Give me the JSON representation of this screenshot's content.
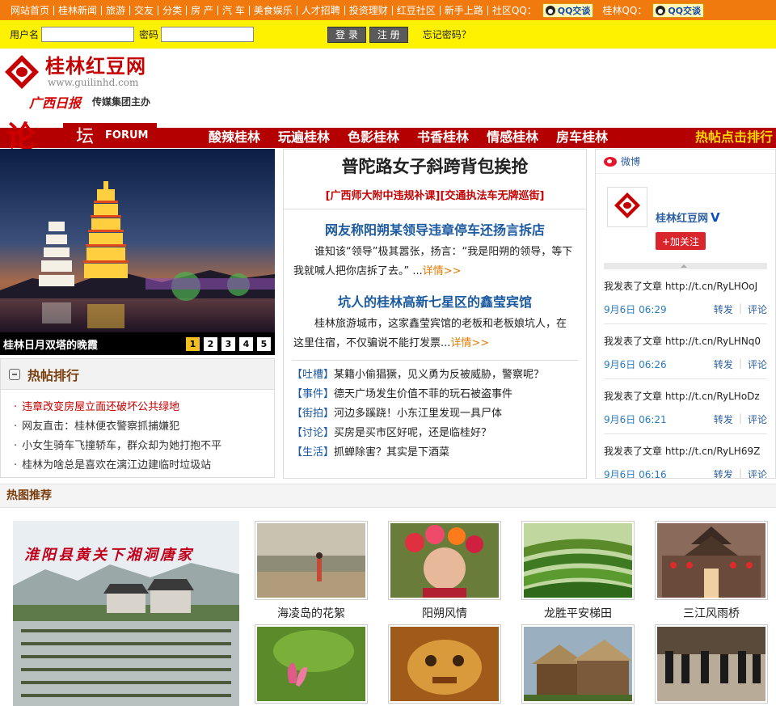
{
  "topnav": {
    "items": [
      "网站首页",
      "桂林新闻",
      "旅游",
      "交友",
      "分类",
      "房 产",
      "汽 车",
      "美食娱乐",
      "人才招聘",
      "投资理财",
      "红豆社区",
      "新手上路"
    ],
    "community_qq_label": "社区QQ：",
    "qq_btn_label": "QQ交谈",
    "guilin_qq_label": "桂林QQ："
  },
  "login": {
    "username_label": "用户名",
    "password_label": "密码",
    "username_value": "",
    "password_value": "",
    "login_btn": "登 录",
    "register_btn": "注 册",
    "forgot": "忘记密码？"
  },
  "logo": {
    "title": "桂林红豆网",
    "url": "www.guilinhd.com",
    "gx": "广西日报",
    "sub": "传媒集团主办"
  },
  "forum": {
    "lun": "论",
    "tan": "坛",
    "en": "FORUM",
    "nav": [
      "酸辣桂林",
      "玩遍桂林",
      "色影桂林",
      "书香桂林",
      "情感桂林",
      "房车桂林"
    ],
    "hot_rank": "热帖点击排行"
  },
  "slideshow": {
    "caption": "桂林日月双塔的晚霞",
    "pages": [
      "1",
      "2",
      "3",
      "4",
      "5"
    ],
    "active": 0
  },
  "hot_posts": {
    "title": "热帖排行",
    "items": [
      "违章改变房屋立面还破坏公共绿地",
      "网友直击：桂林便衣警察抓捕嫌犯",
      "小女生骑车飞撞轿车，群众却为她打抱不平",
      "桂林为啥总是喜欢在漓江边建临时垃圾站"
    ]
  },
  "center": {
    "headline": "普陀路女子斜跨背包挨抢",
    "subhead_1": "广西师大附中违规补课",
    "subhead_2": "交通执法车无牌巡街",
    "stories": [
      {
        "title": "网友称阳朔某领导违章停车还扬言拆店",
        "body": "谁知该“领导”极其嚣张，扬言：“我是阳朔的领导，等下我就喊人把你店拆了去。” ...",
        "more": "详情>>"
      },
      {
        "title": "坑人的桂林高新七星区的鑫莹宾馆",
        "body": "桂林旅游城市，这家鑫莹宾馆的老板和老板娘坑人，在这里住宿，不仅骗说不能打发票...",
        "more": "详情>>"
      }
    ],
    "tagged": [
      {
        "tag": "【吐槽】",
        "text": "某籍小偷猖獗，见义勇为反被威胁，警察呢？"
      },
      {
        "tag": "【事件】",
        "text": "德天广场发生价值不菲的玩石被盗事件"
      },
      {
        "tag": "【街拍】",
        "text": "河边多蹊跷！小东江里发现一具尸体"
      },
      {
        "tag": "【讨论】",
        "text": "买房是买市区好呢，还是临桂好？"
      },
      {
        "tag": "【生活】",
        "text": "抓蝉除害？其实是下酒菜"
      }
    ]
  },
  "weibo": {
    "label": "微博",
    "name": "桂林红豆网",
    "verified": "V",
    "follow": "+加关注",
    "repost": "转发",
    "comment": "评论",
    "posts": [
      {
        "text": "我发表了文章 http://t.cn/RyLHOoJ",
        "time": "9月6日 06:29"
      },
      {
        "text": "我发表了文章 http://t.cn/RyLHNq0",
        "time": "9月6日 06:26"
      },
      {
        "text": "我发表了文章 http://t.cn/RyLHoDz",
        "time": "9月6日 06:21"
      },
      {
        "text": "我发表了文章 http://t.cn/RyLH69Z",
        "time": "9月6日 06:16"
      }
    ]
  },
  "hot_pictures": {
    "title": "热图推荐",
    "big_title": "淮阳县黄关下湘洞唐家",
    "thumbs": [
      "海凌岛的花絮",
      "阳朔风情",
      "龙胜平安梯田",
      "三江风雨桥"
    ]
  }
}
